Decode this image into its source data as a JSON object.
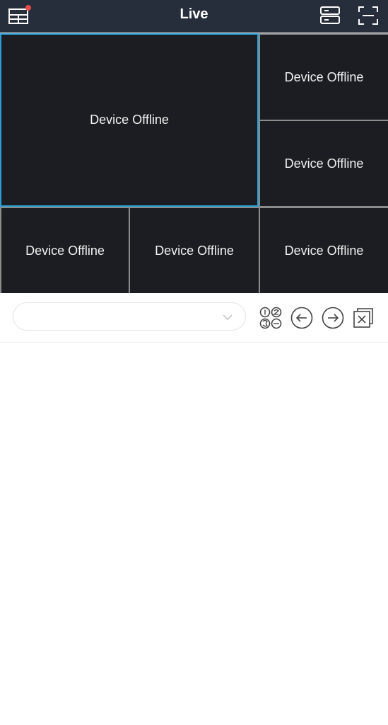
{
  "header": {
    "title": "Live",
    "icons": [
      "layout-icon",
      "device-list-icon",
      "fullscreen-icon"
    ]
  },
  "grid": {
    "tiles": [
      {
        "status": "Device Offline",
        "selected": true
      },
      {
        "status": "Device Offline",
        "selected": false
      },
      {
        "status": "Device Offline",
        "selected": false
      },
      {
        "status": "Device Offline",
        "selected": false
      },
      {
        "status": "Device Offline",
        "selected": false
      },
      {
        "status": "Device Offline",
        "selected": false
      }
    ]
  },
  "controls": {
    "dropdown_value": "",
    "icons": [
      "split-screen-icon",
      "previous-icon",
      "next-icon",
      "close-all-icon"
    ]
  },
  "colors": {
    "header_bg": "#262d3b",
    "tile_bg": "#1c1d22",
    "selected_border": "#2aa0d6",
    "notification_dot": "#e84b4b"
  }
}
